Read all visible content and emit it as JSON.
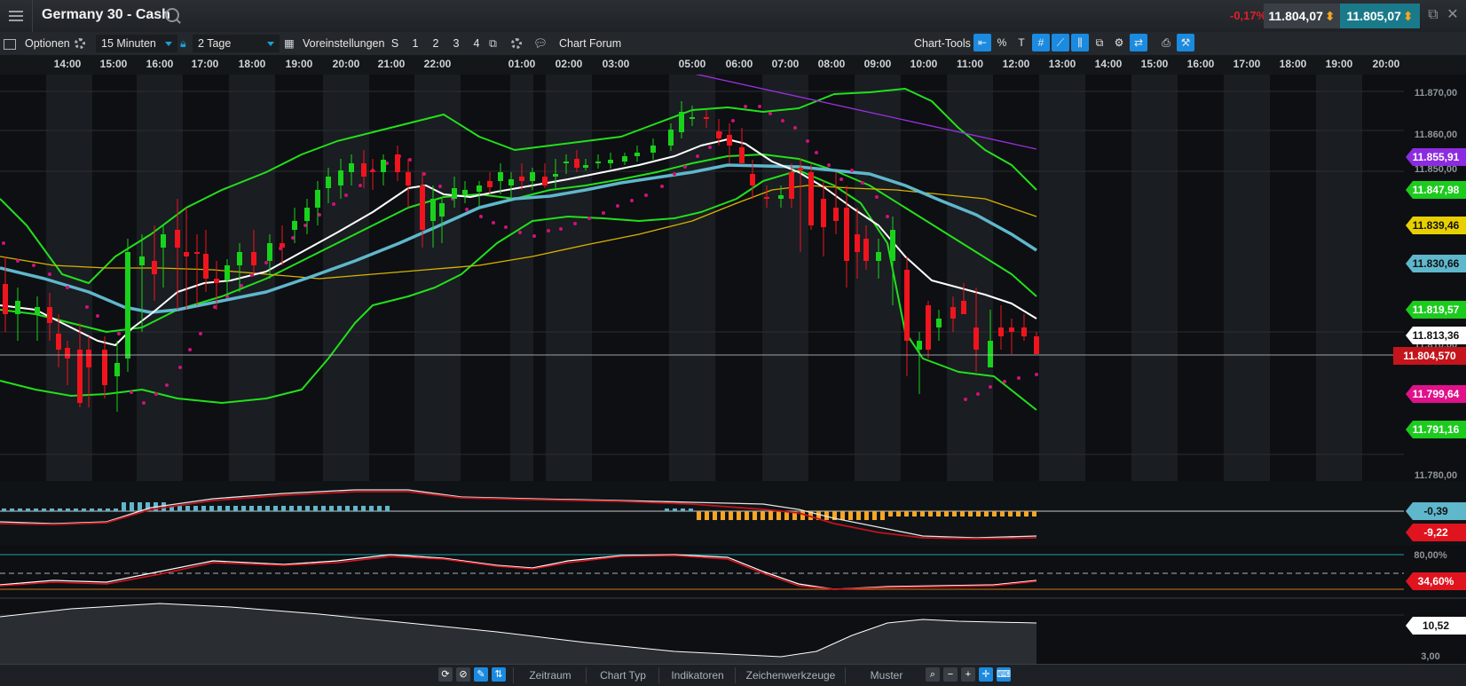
{
  "window": {
    "title": "Germany 30 - Cash",
    "change": "-0,17%",
    "bid": "11.804,07",
    "ask": "11.805,07"
  },
  "toolbar": {
    "options_label": "Optionen",
    "interval_value": "15 Minuten",
    "range_value": "2 Tage",
    "presets_label": "Voreinstellungen",
    "preset_buttons": [
      "S",
      "1",
      "2",
      "3",
      "4"
    ],
    "forum_label": "Chart Forum",
    "chart_tools_label": "Chart-Tools",
    "percent_label": "%"
  },
  "time_axis": [
    "14:00",
    "15:00",
    "16:00",
    "17:00",
    "18:00",
    "19:00",
    "20:00",
    "21:00",
    "22:00",
    "01:00",
    "02:00",
    "03:00",
    "05:00",
    "06:00",
    "07:00",
    "08:00",
    "09:00",
    "10:00",
    "11:00",
    "12:00",
    "13:00",
    "14:00",
    "15:00",
    "16:00",
    "17:00",
    "18:00",
    "19:00",
    "20:00"
  ],
  "price_axis": [
    "11.870,00",
    "11.860,00",
    "11.850,00",
    "11.810,00",
    "11.780,00"
  ],
  "price_tags": {
    "purple": "11.855,91",
    "bb_upper": "11.847,98",
    "yellow": "11.839,46",
    "sma_blue": "11.830,66",
    "bb_mid": "11.819,57",
    "white": "11.813,36",
    "last": "11.804,570",
    "sar": "11.799,64",
    "bb_lower": "11.791,16"
  },
  "macd": {
    "signal_tag": "-0,39",
    "value_tag": "-9,22"
  },
  "stoch": {
    "level_label": "80,00%",
    "value_tag": "34,60%"
  },
  "adx": {
    "value_tag": "10,52",
    "axis_label": "3,00"
  },
  "colors": {
    "up": "#19d21c",
    "down": "#f0141e",
    "bb": "#22e01c",
    "white_ma": "#ffffff",
    "blue_ma": "#5fb7cc",
    "yellow_ma": "#d9b300",
    "purple_line": "#9b30e0",
    "sar": "#d0117a",
    "last_price": "#c4141c"
  },
  "bottom": {
    "buttons": [
      "Zeitraum",
      "Chart Typ",
      "Indikatoren",
      "Zeichenwerkzeuge",
      "Muster"
    ]
  },
  "icons": [
    "menu-icon",
    "search-icon",
    "gear-icon",
    "lock-icon",
    "calendar-icon",
    "chat-icon",
    "zoom-icon"
  ]
}
